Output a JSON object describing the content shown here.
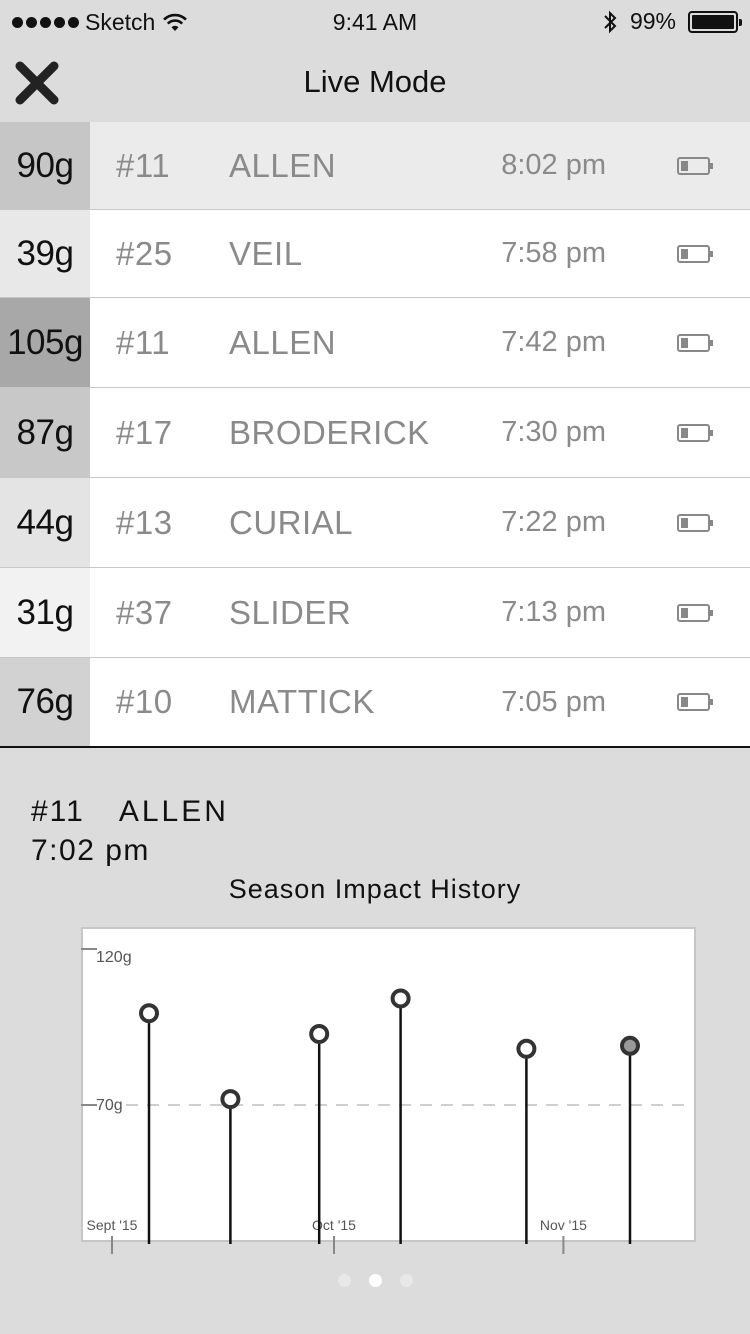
{
  "status_bar": {
    "carrier": "Sketch",
    "time": "9:41 AM",
    "battery": "99%"
  },
  "nav": {
    "title": "Live Mode",
    "close_icon": "close-x-icon"
  },
  "rows": [
    {
      "impact": "90g",
      "number": "#11",
      "name": "ALLEN",
      "time": "8:02 pm",
      "impact_color": "#c6c6c6",
      "selected": true
    },
    {
      "impact": "39g",
      "number": "#25",
      "name": "VEIL",
      "time": "7:58 pm",
      "impact_color": "#e8e8e8",
      "selected": false
    },
    {
      "impact": "105g",
      "number": "#11",
      "name": "ALLEN",
      "time": "7:42 pm",
      "impact_color": "#a8a8a8",
      "selected": false
    },
    {
      "impact": "87g",
      "number": "#17",
      "name": "BRODERICK",
      "time": "7:30 pm",
      "impact_color": "#c8c8c8",
      "selected": false
    },
    {
      "impact": "44g",
      "number": "#13",
      "name": "CURIAL",
      "time": "7:22 pm",
      "impact_color": "#e4e4e4",
      "selected": false
    },
    {
      "impact": "31g",
      "number": "#37",
      "name": "SLIDER",
      "time": "7:13 pm",
      "impact_color": "#f2f2f2",
      "selected": false
    },
    {
      "impact": "76g",
      "number": "#10",
      "name": "MATTICK",
      "time": "7:05 pm",
      "impact_color": "#d2d2d2",
      "selected": false
    }
  ],
  "detail": {
    "number": "#11",
    "name": "ALLEN",
    "time": "7:02 pm",
    "chart_title": "Season Impact History"
  },
  "chart_data": {
    "type": "scatter",
    "title": "Season Impact History",
    "y_ticks": [
      {
        "value": 120,
        "label": "120g"
      },
      {
        "value": 70,
        "label": "70g"
      }
    ],
    "x_ticks": [
      {
        "value": 0,
        "label": "Sept '15"
      },
      {
        "value": 30,
        "label": "Oct '15"
      },
      {
        "value": 61,
        "label": "Nov '15"
      }
    ],
    "ylim": [
      30,
      120
    ],
    "xlim": [
      -4,
      82
    ],
    "reference_line": 70,
    "points": [
      {
        "x": 5,
        "y": 101,
        "highlight": false
      },
      {
        "x": 16,
        "y": 72,
        "highlight": false
      },
      {
        "x": 28,
        "y": 94,
        "highlight": false
      },
      {
        "x": 39,
        "y": 106,
        "highlight": false
      },
      {
        "x": 56,
        "y": 89,
        "highlight": false
      },
      {
        "x": 70,
        "y": 90,
        "highlight": true
      }
    ],
    "grid": false,
    "legend": "none"
  },
  "pager": {
    "count": 3,
    "active": 1
  }
}
